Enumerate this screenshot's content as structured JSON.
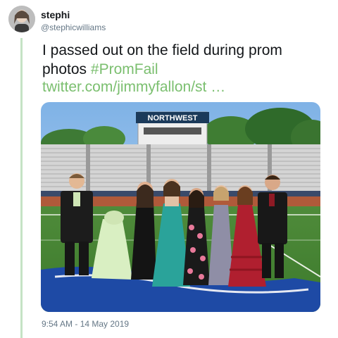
{
  "user": {
    "name": "stephi",
    "handle": "@stephicwilliams"
  },
  "tweet": {
    "text": "I passed out on the field during prom photos ",
    "hashtag": "#PromFail",
    "link": "twitter.com/jimmyfallon/st …",
    "timestamp": "9:54 AM - 14 May 2019"
  },
  "photo": {
    "sign_text": "NORTHWEST"
  },
  "colors": {
    "accent": "#7bbf6f",
    "thread_line": "#c5e3c5",
    "muted": "#657786"
  }
}
